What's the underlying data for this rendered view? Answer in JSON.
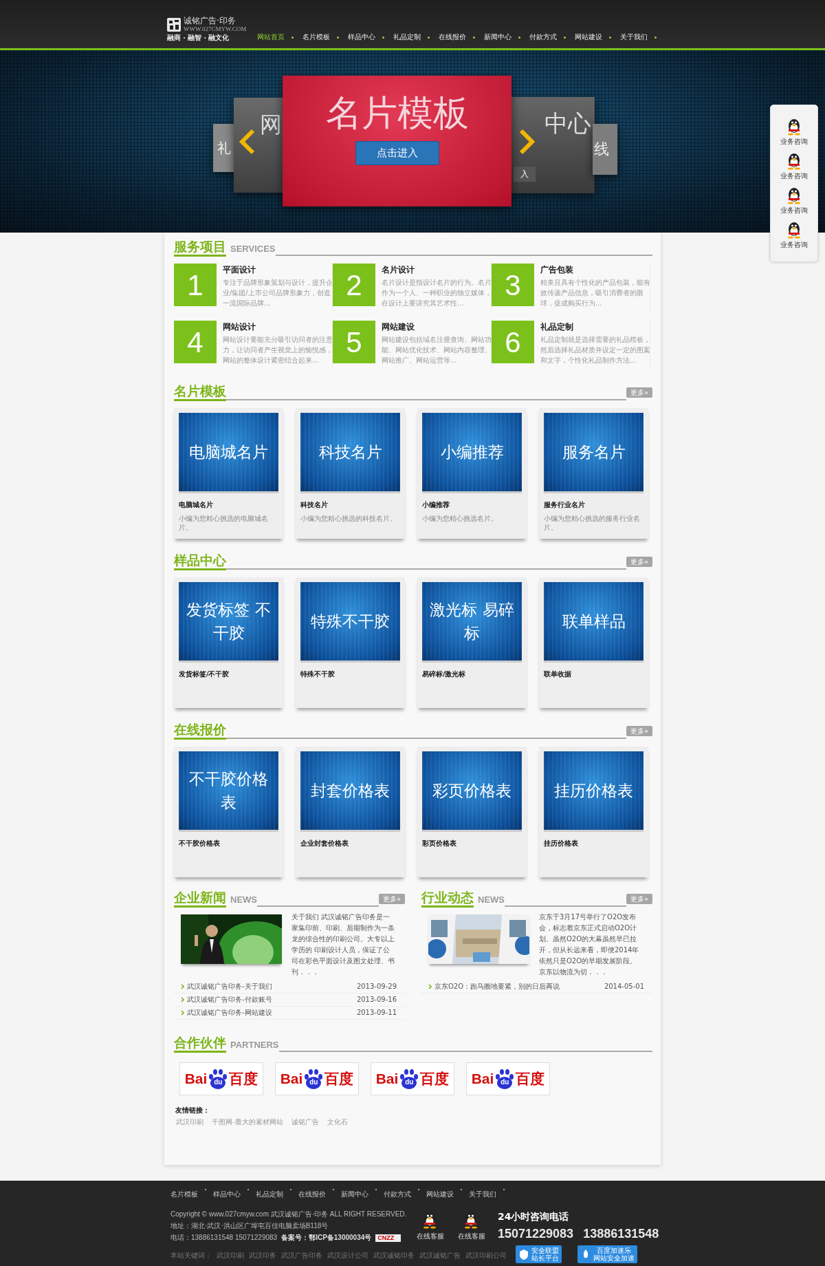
{
  "header": {
    "logo_title": "诚铭广告·印务",
    "logo_url": "WWW.027CMYW.COM",
    "slogan": "融商 · 融智 · 融文化",
    "nav": [
      {
        "label": "网站首页",
        "selected": true
      },
      {
        "label": "名片模板",
        "selected": false
      },
      {
        "label": "样品中心",
        "selected": false
      },
      {
        "label": "礼品定制",
        "selected": false
      },
      {
        "label": "在线报价",
        "selected": false
      },
      {
        "label": "新闻中心",
        "selected": false
      },
      {
        "label": "付款方式",
        "selected": false
      },
      {
        "label": "网站建设",
        "selected": false
      },
      {
        "label": "关于我们",
        "selected": false
      }
    ]
  },
  "banner": {
    "slides": [
      {
        "kind": "far-left",
        "title": "礼"
      },
      {
        "kind": "left",
        "title": "网"
      },
      {
        "kind": "main",
        "title": "名片模板",
        "button": "点击进入"
      },
      {
        "kind": "right",
        "title": "中心",
        "button": "入"
      },
      {
        "kind": "far-right",
        "title": "线"
      }
    ]
  },
  "side_panel": {
    "items": [
      {
        "label": "业务咨询"
      },
      {
        "label": "业务咨询"
      },
      {
        "label": "业务咨询"
      },
      {
        "label": "业务咨询"
      }
    ]
  },
  "services": {
    "title": "服务项目",
    "subtitle": "SERVICES",
    "items": [
      {
        "number": "1",
        "title": "平面设计",
        "text": "专注于品牌形象策划与设计，提升企业/集团/上市公司品牌形象力，创造一流国际品牌..."
      },
      {
        "number": "2",
        "title": "名片设计",
        "text": "名片设计是指设计名片的行为。名片作为一个人、一种职业的独立媒体，在设计上要讲究其艺术性..."
      },
      {
        "number": "3",
        "title": "广告包装",
        "text": "精美且具有个性化的产品包装，能有效传递产品信息，吸引消费者的眼球，促成购买行为..."
      },
      {
        "number": "4",
        "title": "网站设计",
        "text": "网站设计要能充分吸引访问者的注意力，让访问者产生视觉上的愉悦感，网站的整体设计紧密结合起来..."
      },
      {
        "number": "5",
        "title": "网站建设",
        "text": "网站建设包括域名注册查询、网站功能、网站优化技术、网站内容整理、网站推广、网站运营等..."
      },
      {
        "number": "6",
        "title": "礼品定制",
        "text": "礼品定制就是选择需要的礼品模板，然后选择礼品材质并设定一定的图案和文字，个性化礼品制作方法..."
      }
    ]
  },
  "galleries": [
    {
      "title": "名片模板",
      "more": "更多»",
      "cards": [
        {
          "image_text": "电脑城名片",
          "title": "电脑城名片",
          "text": "小编为您精心挑选的电脑城名片。"
        },
        {
          "image_text": "科技名片",
          "title": "科技名片",
          "text": "小编为您精心挑选的科技名片。"
        },
        {
          "image_text": "小编推荐",
          "title": "小编推荐",
          "text": "小编为您精心挑选名片。"
        },
        {
          "image_text": "服务名片",
          "title": "服务行业名片",
          "text": "小编为您精心挑选的服务行业名片。"
        }
      ]
    },
    {
      "title": "样品中心",
      "more": "更多»",
      "cards": [
        {
          "image_text": "发货标签 不干胶",
          "title": "发货标签/不干胶"
        },
        {
          "image_text": "特殊不干胶",
          "title": "特殊不干胶"
        },
        {
          "image_text": "激光标 易碎标",
          "title": "易碎标/激光标"
        },
        {
          "image_text": "联单样品",
          "title": "联单收据"
        }
      ]
    },
    {
      "title": "在线报价",
      "more": "更多»",
      "cards": [
        {
          "image_text": "不干胶价格表",
          "title": "不干胶价格表"
        },
        {
          "image_text": "封套价格表",
          "title": "企业封套价格表"
        },
        {
          "image_text": "彩页价格表",
          "title": "彩页价格表"
        },
        {
          "image_text": "挂历价格表",
          "title": "挂历价格表"
        }
      ]
    }
  ],
  "news": [
    {
      "title": "企业新闻",
      "subtitle": "NEWS",
      "more": "更多»",
      "picture": {
        "kind": "picture"
      },
      "summary": "关于我们 武汉诚铭广告印务是一家集印前、印刷、后期制作为一条龙的综合性的印刷公司。大专以上学历的 印刷设计人员，保证了公司在彩色平面设计及图文处理、书刊．．．",
      "items": [
        {
          "title": "武汉诚铭广告印务-关于我们",
          "date": "2013-09-29"
        },
        {
          "title": "武汉诚铭广告印务-付款账号",
          "date": "2013-09-16"
        },
        {
          "title": "武汉诚铭广告印务-网站建设",
          "date": "2013-09-11"
        }
      ]
    },
    {
      "title": "行业动态",
      "subtitle": "NEWS",
      "more": "更多»",
      "picture": {
        "kind": "picture"
      },
      "summary": "京东于3月17号举行了O2O发布会，标志着京东正式启动O2O计划。虽然O2O的大幕虽然早已拉开，但从长远来看，即便2014年依然只是O2O的早期发展阶段。京东以物流为切．．．",
      "items": [
        {
          "title": "京东O2O：跑马圈地要紧，别的日后再说",
          "date": "2014-05-01"
        }
      ]
    }
  ],
  "partners": {
    "title": "合作伙伴",
    "subtitle": "PARTNERS",
    "logos": [
      {
        "latin": "Bai",
        "mark": "du",
        "chinese": "百度"
      },
      {
        "latin": "Bai",
        "mark": "du",
        "chinese": "百度"
      },
      {
        "latin": "Bai",
        "mark": "du",
        "chinese": "百度"
      },
      {
        "latin": "Bai",
        "mark": "du",
        "chinese": "百度"
      }
    ],
    "links_label": "友情链接：",
    "links": [
      "武汉印刷",
      "千图网-最大的素材网站",
      "诚铭广告",
      "文化石"
    ]
  },
  "footer": {
    "nav": [
      "名片模板",
      "样品中心",
      "礼品定制",
      "在线报价",
      "新闻中心",
      "付款方式",
      "网站建设",
      "关于我们"
    ],
    "copyright": "Copyright © www.027cmyw.com 武汉诚铭广告·印务 ALL RIGHT RESERVED.",
    "address": "地址：湖北·武汉·洪山区广埠屯百佳电脑卖场B118号",
    "phone": "电话：13886131548 15071229083",
    "icp": "备案号：鄂ICP备13000034号",
    "counter_badge": "CNZZ",
    "service": [
      "在线客服",
      "在线客服"
    ],
    "hotline_title": "24小时咨询电话",
    "hotlines": [
      "15071229083",
      "13886131548"
    ],
    "keywords_label": "本站关键词：",
    "keywords": [
      "武汉印刷",
      "武汉印务",
      "武汉广告印务",
      "武汉设计公司",
      "武汉诚铭印务",
      "武汉诚铭广告",
      "武汉印刷公司"
    ],
    "badges": [
      {
        "title": "安全联盟",
        "text": "站长平台"
      },
      {
        "title": "百度加速乐",
        "text": "网站安全加速"
      }
    ]
  }
}
